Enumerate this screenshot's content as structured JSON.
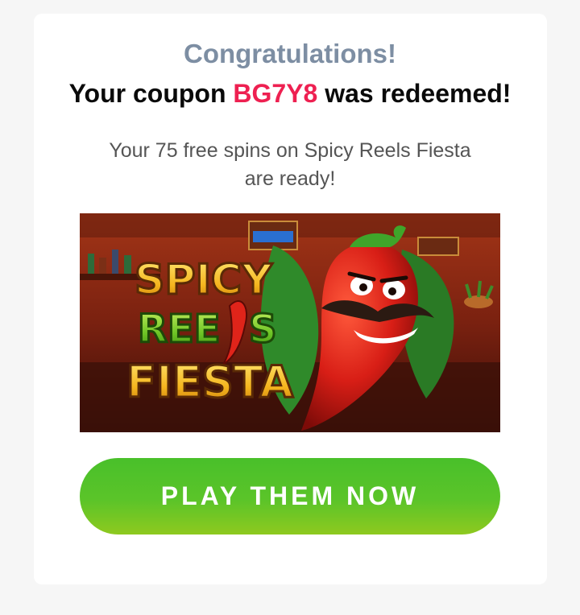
{
  "page": {
    "title": "Congratulations!",
    "headline": {
      "before": "Your coupon ",
      "code": "BG7Y8",
      "after": " was redeemed!"
    },
    "subtitle_line1": "Your 75 free spins on Spicy Reels Fiesta",
    "subtitle_line2": "are ready!"
  },
  "banner": {
    "logo_line1": "SPICY",
    "logo_line2_left": "REE",
    "logo_line2_right": "S",
    "logo_line3": "FIESTA"
  },
  "cta": {
    "label": "PLAY THEM NOW"
  },
  "colors": {
    "background": "#f6f6f6",
    "card": "#ffffff",
    "title": "#7d8ea3",
    "coupon_code": "#ee2051",
    "cta_green": "#5bc429"
  }
}
